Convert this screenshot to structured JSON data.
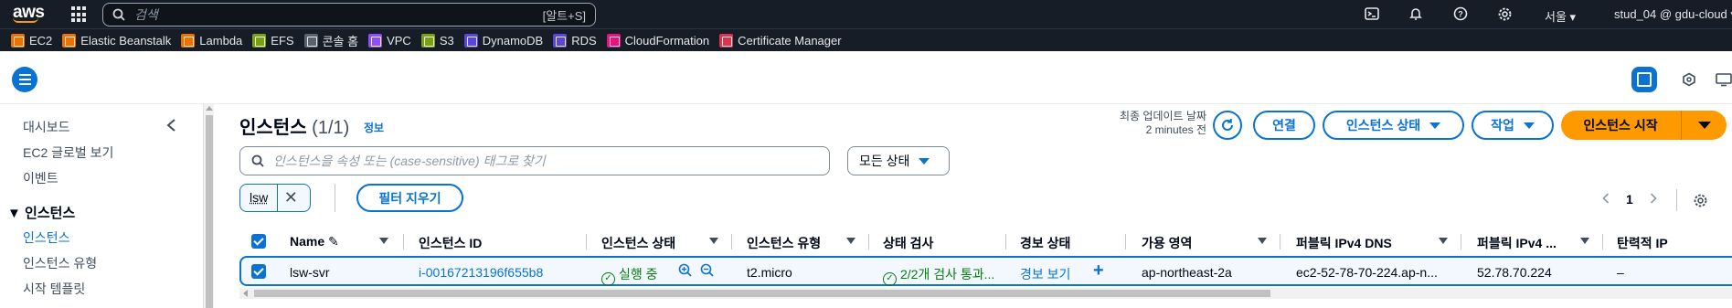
{
  "topnav": {
    "logo": "aws",
    "search_placeholder": "검색",
    "search_shortcut": "[알트+S]",
    "region": "서울 ▾",
    "user": "stud_04 @ gdu-cloud ▾",
    "icons": [
      "cloudshell-icon",
      "bell-icon",
      "help-icon",
      "gear-icon"
    ]
  },
  "favorites": [
    {
      "label": "EC2",
      "color": "#ed7100"
    },
    {
      "label": "Elastic Beanstalk",
      "color": "#ed7100"
    },
    {
      "label": "Lambda",
      "color": "#ed7100"
    },
    {
      "label": "EFS",
      "color": "#7aa116"
    },
    {
      "label": "콘솔 홈",
      "color": "#5a6270"
    },
    {
      "label": "VPC",
      "color": "#8c4fff"
    },
    {
      "label": "S3",
      "color": "#7aa116"
    },
    {
      "label": "DynamoDB",
      "color": "#5a46dd"
    },
    {
      "label": "RDS",
      "color": "#5a46dd"
    },
    {
      "label": "CloudFormation",
      "color": "#e7157b"
    },
    {
      "label": "Certificate Manager",
      "color": "#dd344c"
    }
  ],
  "sidebar": {
    "items": [
      {
        "label": "대시보드"
      },
      {
        "label": "EC2 글로벌 보기"
      },
      {
        "label": "이벤트"
      }
    ],
    "section_title": "▼ 인스턴스",
    "section_items": [
      {
        "label": "인스턴스"
      },
      {
        "label": "인스턴스 유형"
      },
      {
        "label": "시작 템플릿"
      }
    ]
  },
  "main": {
    "title": "인스턴스",
    "count": "(1/1)",
    "info": "정보",
    "updated_label": "최종 업데이트 날짜",
    "updated_value": "2 minutes 전",
    "connect": "연결",
    "instance_state": "인스턴스 상태",
    "actions": "작업",
    "launch": "인스턴스 시작",
    "filter_placeholder": "인스턴스을 속성 또는 (case-sensitive) 태그로 찾기",
    "state_filter": "모든 상태",
    "token": "lsw",
    "clear_filters": "필터 지우기",
    "page": "1"
  },
  "table": {
    "headers": [
      "Name ✎",
      "인스턴스 ID",
      "인스턴스 상태",
      "인스턴스 유형",
      "상태 검사",
      "경보 상태",
      "가용 영역",
      "퍼블릭 IPv4 DNS",
      "퍼블릭 IPv4 ...",
      "탄력적 IP"
    ],
    "row": {
      "name": "lsw-svr",
      "id": "i-00167213196f655b8",
      "state": "실행 중",
      "type": "t2.micro",
      "check": "2/2개 검사 통과...",
      "alarm": "경보 보기",
      "az": "ap-northeast-2a",
      "dns": "ec2-52-78-70-224.ap-n...",
      "ip": "52.78.70.224",
      "eip": "–"
    }
  }
}
